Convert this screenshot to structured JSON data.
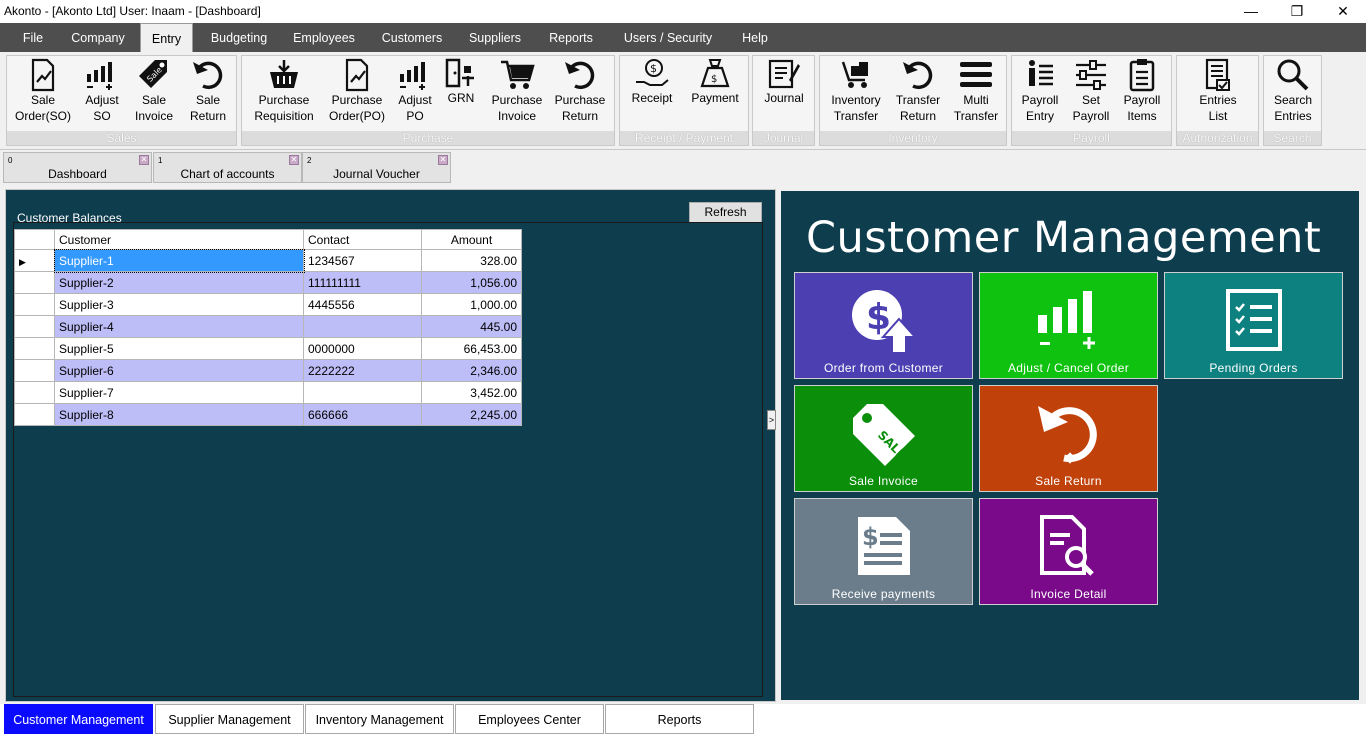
{
  "window": {
    "title": "Akonto - [Akonto Ltd]  User: Inaam - [Dashboard]",
    "controls": [
      "—",
      "❐",
      "✕"
    ]
  },
  "menu": [
    "File",
    "Company",
    "Entry",
    "Budgeting",
    "Employees",
    "Customers",
    "Suppliers",
    "Reports",
    "Users / Security",
    "Help"
  ],
  "active_menu": "Entry",
  "ribbon": {
    "groups": [
      {
        "label": "Sales",
        "buttons": [
          {
            "l1": "Sale",
            "l2": "Order(SO)",
            "icon": "sale-order-icon"
          },
          {
            "l1": "Adjust",
            "l2": "SO",
            "icon": "adjust-so-icon"
          },
          {
            "l1": "Sale",
            "l2": "Invoice",
            "icon": "sale-tag-icon"
          },
          {
            "l1": "Sale",
            "l2": "Return",
            "icon": "return-icon"
          }
        ]
      },
      {
        "label": "Purchase",
        "buttons": [
          {
            "l1": "Purchase",
            "l2": "Requisition",
            "icon": "basket-icon"
          },
          {
            "l1": "Purchase",
            "l2": "Order(PO)",
            "icon": "purchase-order-icon"
          },
          {
            "l1": "Adjust",
            "l2": "PO",
            "icon": "adjust-po-icon"
          },
          {
            "l1": "GRN",
            "l2": "",
            "icon": "grn-icon"
          },
          {
            "l1": "Purchase",
            "l2": "Invoice",
            "icon": "cart-icon"
          },
          {
            "l1": "Purchase",
            "l2": "Return",
            "icon": "return-icon"
          }
        ]
      },
      {
        "label": "Receipt / Payment",
        "buttons": [
          {
            "l1": "Receipt",
            "l2": "",
            "icon": "receipt-icon"
          },
          {
            "l1": "Payment",
            "l2": "",
            "icon": "payment-icon"
          }
        ]
      },
      {
        "label": "Journal",
        "buttons": [
          {
            "l1": "Journal",
            "l2": "",
            "icon": "journal-icon"
          }
        ]
      },
      {
        "label": "Inventory",
        "buttons": [
          {
            "l1": "Inventory",
            "l2": "Transfer",
            "icon": "inventory-transfer-icon"
          },
          {
            "l1": "Transfer",
            "l2": "Return",
            "icon": "return-icon"
          },
          {
            "l1": "Multi",
            "l2": "Transfer",
            "icon": "multi-transfer-icon"
          }
        ]
      },
      {
        "label": "Payroll",
        "buttons": [
          {
            "l1": "Payroll",
            "l2": "Entry",
            "icon": "payroll-entry-icon"
          },
          {
            "l1": "Set",
            "l2": "Payroll",
            "icon": "sliders-icon"
          },
          {
            "l1": "Payroll",
            "l2": "Items",
            "icon": "clipboard-icon"
          }
        ]
      },
      {
        "label": "Authorization",
        "buttons": [
          {
            "l1": "Entries",
            "l2": "List",
            "icon": "entries-list-icon"
          }
        ]
      },
      {
        "label": "Search",
        "buttons": [
          {
            "l1": "Search",
            "l2": "Entries",
            "icon": "search-icon"
          }
        ]
      }
    ]
  },
  "doc_tabs": [
    {
      "num": "0",
      "label": "Dashboard"
    },
    {
      "num": "1",
      "label": "Chart of accounts"
    },
    {
      "num": "2",
      "label": "Journal Voucher"
    }
  ],
  "customer_balances": {
    "title": "Customer Balances",
    "refresh_label": "Refresh",
    "columns": [
      "Customer",
      "Contact",
      "Amount"
    ],
    "rows": [
      {
        "name": "Supplier-1",
        "contact": "1234567",
        "amount": "328.00"
      },
      {
        "name": "Supplier-2",
        "contact": "111111111",
        "amount": "1,056.00"
      },
      {
        "name": "Supplier-3",
        "contact": "4445556",
        "amount": "1,000.00"
      },
      {
        "name": "Supplier-4",
        "contact": "",
        "amount": "445.00"
      },
      {
        "name": "Supplier-5",
        "contact": "0000000",
        "amount": "66,453.00"
      },
      {
        "name": "Supplier-6",
        "contact": "2222222",
        "amount": "2,346.00"
      },
      {
        "name": "Supplier-7",
        "contact": "",
        "amount": "3,452.00"
      },
      {
        "name": "Supplier-8",
        "contact": "666666",
        "amount": "2,245.00"
      }
    ]
  },
  "customer_management": {
    "title": "Customer Management",
    "tiles": [
      {
        "label": "Order from Customer",
        "color": "#4b3fb1",
        "icon": "dollar-upload-icon"
      },
      {
        "label": "Adjust / Cancel Order",
        "color": "#10c210",
        "icon": "adjust-bars-icon"
      },
      {
        "label": "Pending Orders",
        "color": "#0d8080",
        "icon": "checklist-icon"
      },
      {
        "label": "Sale Invoice",
        "color": "#0b8f0b",
        "icon": "sale-tag-icon"
      },
      {
        "label": "Sale Return",
        "color": "#c0410a",
        "icon": "return-icon"
      },
      {
        "label": "Receive payments",
        "color": "#6b7d8a",
        "icon": "dollar-document-icon"
      },
      {
        "label": "Invoice Detail",
        "color": "#7a0a8a",
        "icon": "document-search-icon"
      }
    ]
  },
  "bottom_tabs": [
    "Customer Management",
    "Supplier Management",
    "Inventory Management",
    "Employees Center",
    "Reports"
  ],
  "active_bottom_tab": "Customer Management"
}
